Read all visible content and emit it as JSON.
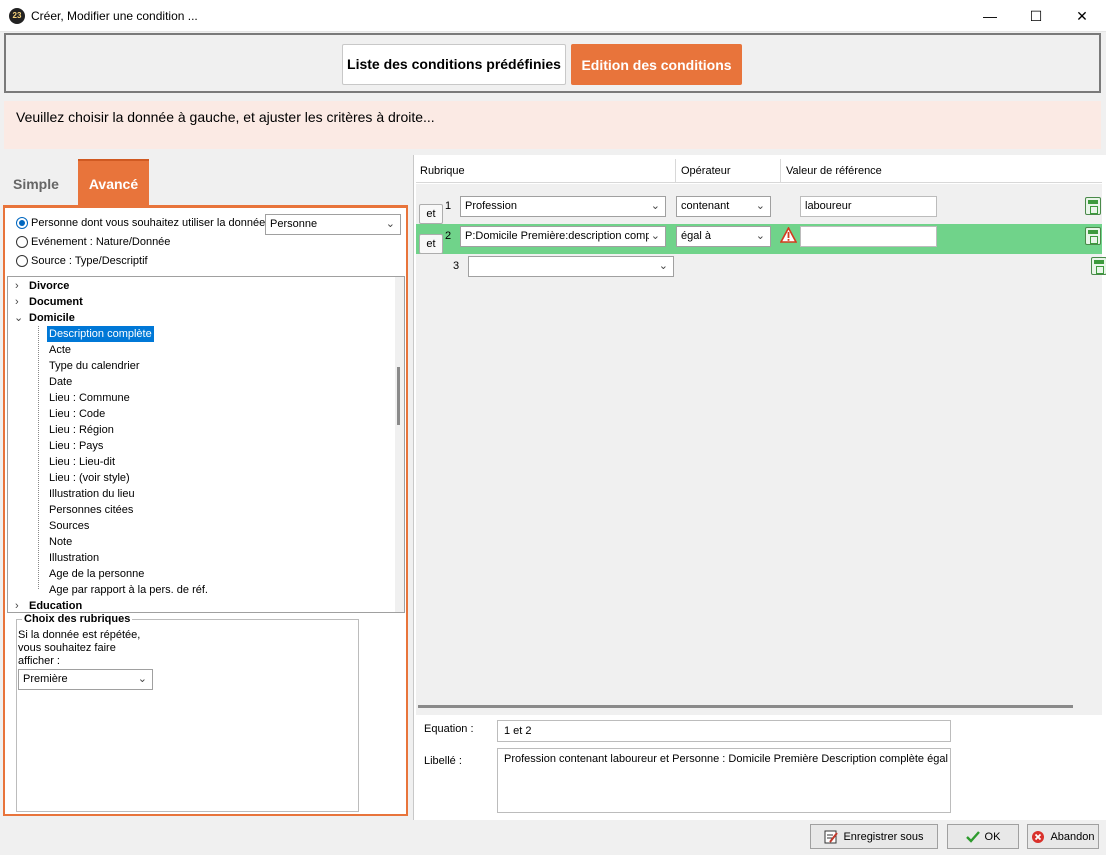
{
  "window": {
    "title": "Créer, Modifier une condition ...",
    "app_icon": "23",
    "controls": {
      "minimize": "—",
      "maximize": "☐",
      "close": "✕"
    }
  },
  "top_tabs": {
    "predefined": "Liste des conditions prédéfinies",
    "edition": "Edition des conditions"
  },
  "info": "Veuillez choisir la donnée à gauche, et ajuster les critères à droite...",
  "left": {
    "tabs": {
      "simple": "Simple",
      "avance": "Avancé"
    },
    "radios": [
      {
        "label": "Personne dont vous souhaitez utiliser la donnée",
        "selected": true
      },
      {
        "label": "Evénement : Nature/Donnée",
        "selected": false
      },
      {
        "label": "Source : Type/Descriptif",
        "selected": false
      }
    ],
    "person_select": "Personne",
    "tree": {
      "groups": [
        {
          "label": "Divorce",
          "expanded": false
        },
        {
          "label": "Document",
          "expanded": false
        },
        {
          "label": "Domicile",
          "expanded": true
        },
        {
          "label": "Education",
          "expanded": false
        }
      ],
      "children": [
        "Description complète",
        "Acte",
        "Type du calendrier",
        "Date",
        "Lieu : Commune",
        "Lieu : Code",
        "Lieu : Région",
        "Lieu : Pays",
        "Lieu : Lieu-dit",
        "Lieu : (voir style)",
        "Illustration du lieu",
        "Personnes citées",
        "Sources",
        "Note",
        "Illustration",
        "Age de la personne",
        "Age par rapport à la pers. de réf."
      ],
      "selected_child": "Description complète"
    },
    "choix": {
      "title": "Choix des rubriques",
      "text_lines": [
        "Si la donnée est répétée,",
        "vous souhaitez faire",
        "afficher :"
      ],
      "select": "Première"
    }
  },
  "grid": {
    "headers": {
      "rubrique": "Rubrique",
      "operateur": "Opérateur",
      "valeur": "Valeur de référence"
    },
    "rows": [
      {
        "et": "et",
        "num": "1",
        "rubrique": "Profession",
        "operateur": "contenant",
        "valeur": "laboureur"
      },
      {
        "et": "et",
        "num": "2",
        "rubrique": "P:Domicile Première:description complè",
        "operateur": "égal à",
        "valeur": ""
      },
      {
        "num": "3",
        "rubrique": ""
      }
    ]
  },
  "equation": {
    "label": "Equation :",
    "value": "1 et 2"
  },
  "libelle": {
    "label": "Libellé :",
    "value": "Profession contenant laboureur et Personne : Domicile Première Description complète égal à"
  },
  "buttons": {
    "save_as": "Enregistrer sous",
    "ok": "OK",
    "cancel": "Abandon"
  },
  "colors": {
    "accent": "#e8743b",
    "row_highlight": "#70d38a",
    "selection": "#0078d7"
  }
}
